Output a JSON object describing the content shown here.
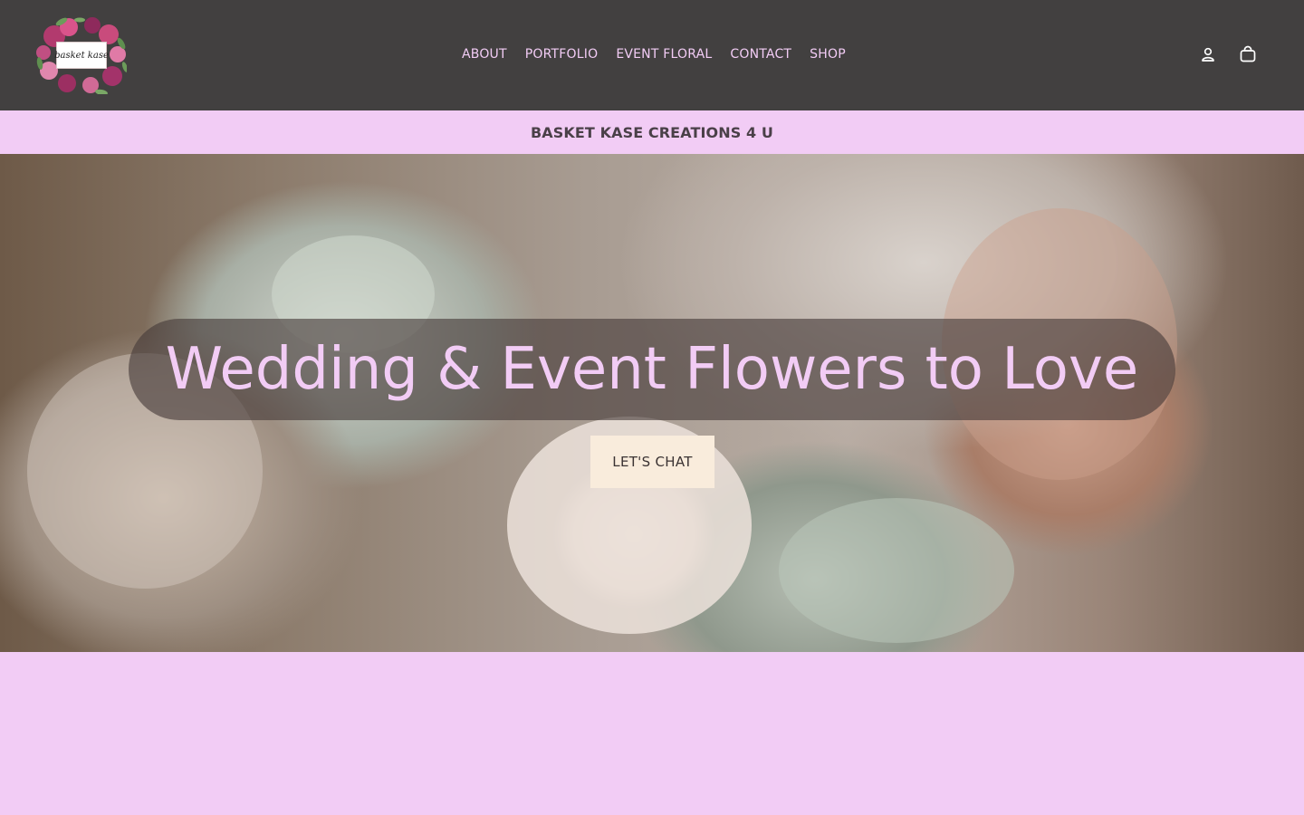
{
  "brand": {
    "logo_text": "basket kase",
    "name": "BASKET KASE CREATIONS 4 U"
  },
  "nav": {
    "items": [
      {
        "label": "ABOUT"
      },
      {
        "label": "PORTFOLIO"
      },
      {
        "label": "EVENT FLORAL"
      },
      {
        "label": "CONTACT"
      },
      {
        "label": "SHOP"
      }
    ]
  },
  "header_icons": {
    "account": "account-icon",
    "cart": "cart-icon"
  },
  "hero": {
    "headline": "Wedding & Event Flowers to Love",
    "cta_label": "LET'S CHAT"
  },
  "colors": {
    "header_bg": "#424040",
    "accent_pink": "#f2ccf5",
    "cta_bg": "#f9ecdc"
  }
}
